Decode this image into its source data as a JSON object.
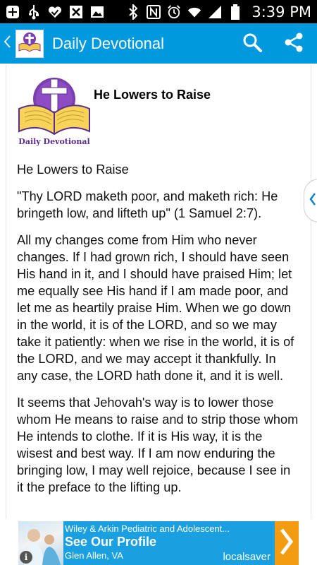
{
  "status_bar": {
    "time": "3:39 PM",
    "left_icons": [
      "add-icon",
      "usb-icon",
      "check-heart-icon",
      "wrong-image-icon",
      "image-icon"
    ],
    "right_icons": [
      "bluetooth-icon",
      "nfc-icon",
      "alarm-icon",
      "wifi-icon",
      "signal-icon",
      "battery-icon"
    ]
  },
  "action_bar": {
    "title": "Daily Devotional",
    "back_icon": "chevron-left-icon",
    "logo_label": "Daily Devotional",
    "actions": [
      "search-icon",
      "share-icon"
    ],
    "color": "#0099dd"
  },
  "post": {
    "logo_caption": "Daily Devotional",
    "title": "He Lowers to Raise",
    "subtitle": "He Lowers to Raise",
    "verse": "\"Thy LORD maketh poor, and maketh rich: He bringeth low, and lifteth up\" (1 Samuel 2:7).",
    "paragraph1": "All my changes come from Him who never changes. If I had grown rich, I should have seen His hand in it, and I should have praised Him; let me equally see His hand if I am made poor, and let me as heartily praise Him. When we go down in the world, it is of the LORD, and so we may take it patiently: when we rise in the world, it is of the LORD, and we may accept it thankfully. In any case, the LORD hath done it, and it is well.",
    "paragraph2": "It seems that Jehovah's way is to lower those whom He means to raise and to strip those whom He intends to clothe. If it is His way, it is the wisest and best way. If I am now enduring the bringing low, I may well rejoice, because I see in it the preface to the lifting up."
  },
  "side_tab": {
    "icon": "chevron-left-icon"
  },
  "ad": {
    "line1": "Wiley & Arkin Pediatric and Adolescent...",
    "line2": "See Our Profile",
    "line3": "Glen Allen, VA",
    "brand": "localsaver",
    "info": "i",
    "color": "#1aa0e0",
    "arrow_color": "#f39c12"
  }
}
